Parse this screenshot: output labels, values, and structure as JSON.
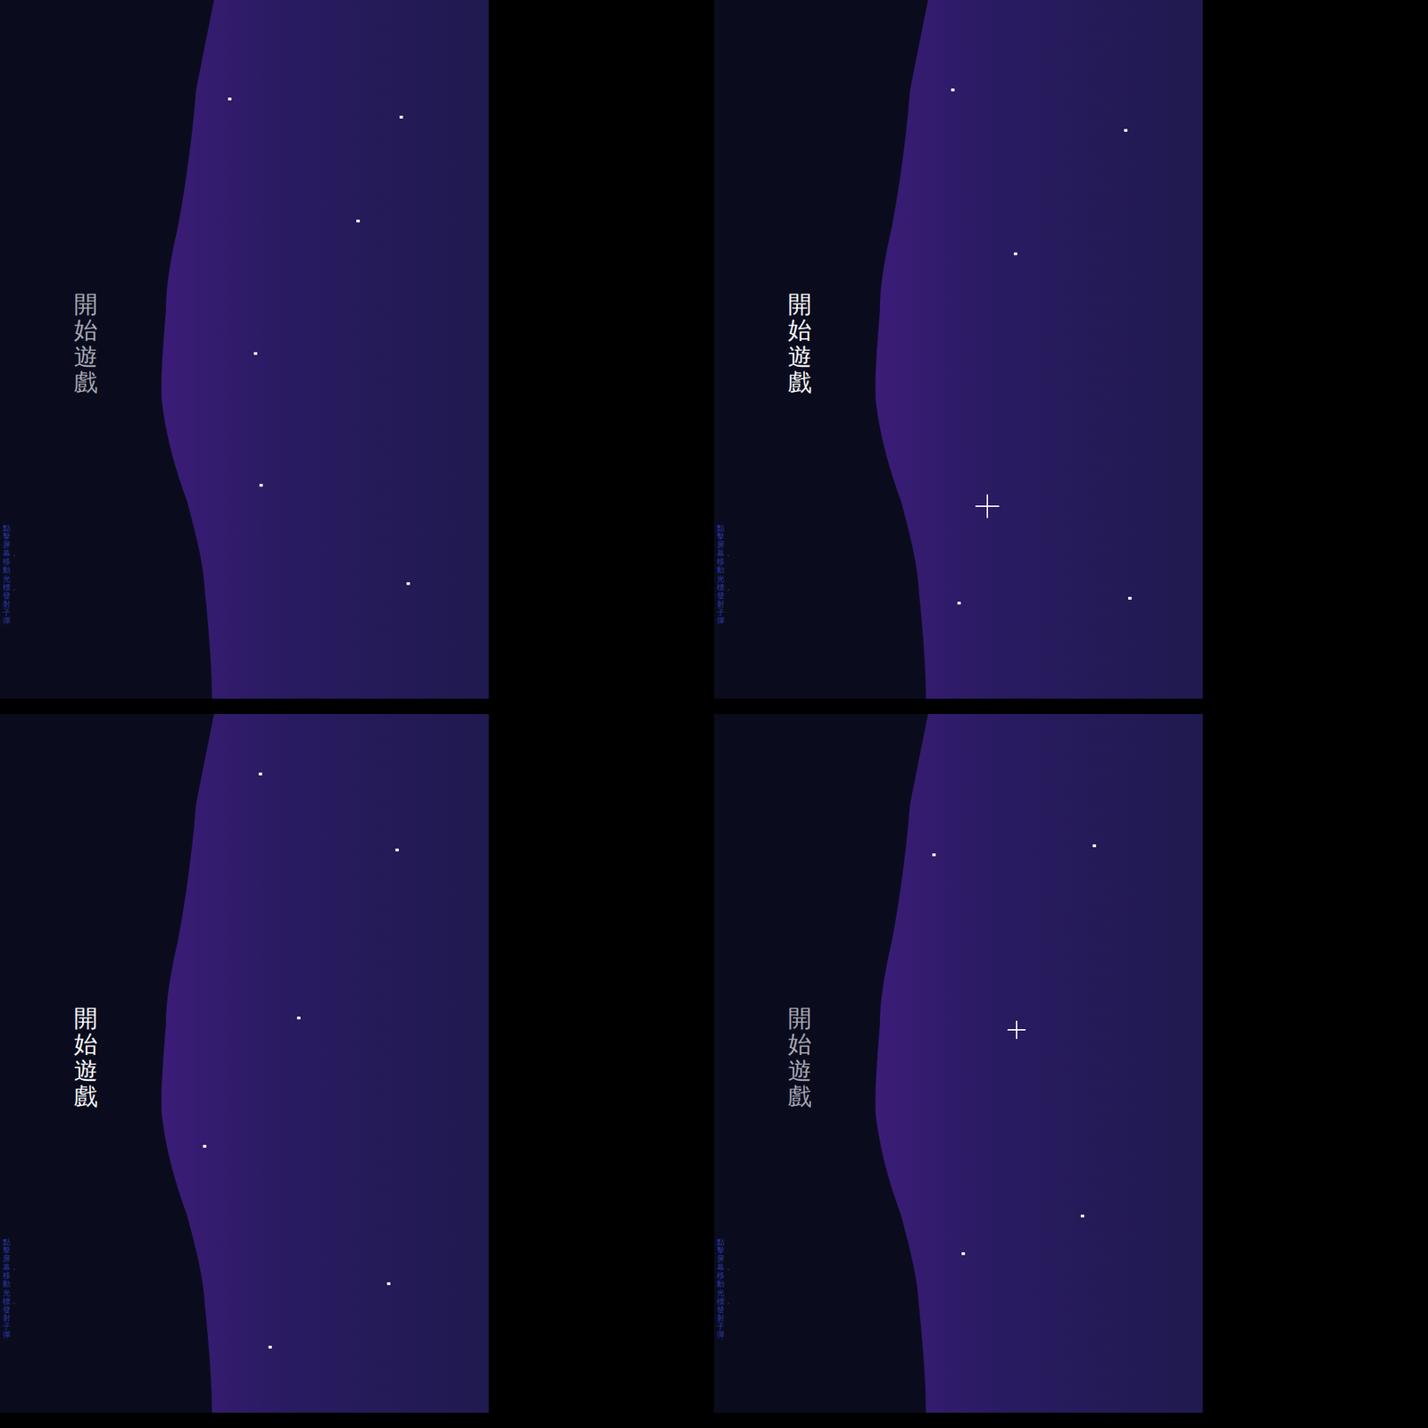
{
  "panels": [
    {
      "title": "開始遊戲",
      "highlighted": false,
      "hint": "點擊屏幕，移動光標，發射子彈",
      "cursor_visible": false
    },
    {
      "title": "開始遊戲",
      "highlighted": true,
      "hint": "點擊屏幕，移動光標，發射子彈",
      "cursor_visible": true
    },
    {
      "title": "開始遊戲",
      "highlighted": true,
      "hint": "點擊屏幕，移動光標，發射子彈",
      "cursor_visible": false
    },
    {
      "title": "開始遊戲",
      "highlighted": false,
      "hint": "點擊屏幕，移動光標，發射子彈",
      "cursor_visible": true
    }
  ]
}
